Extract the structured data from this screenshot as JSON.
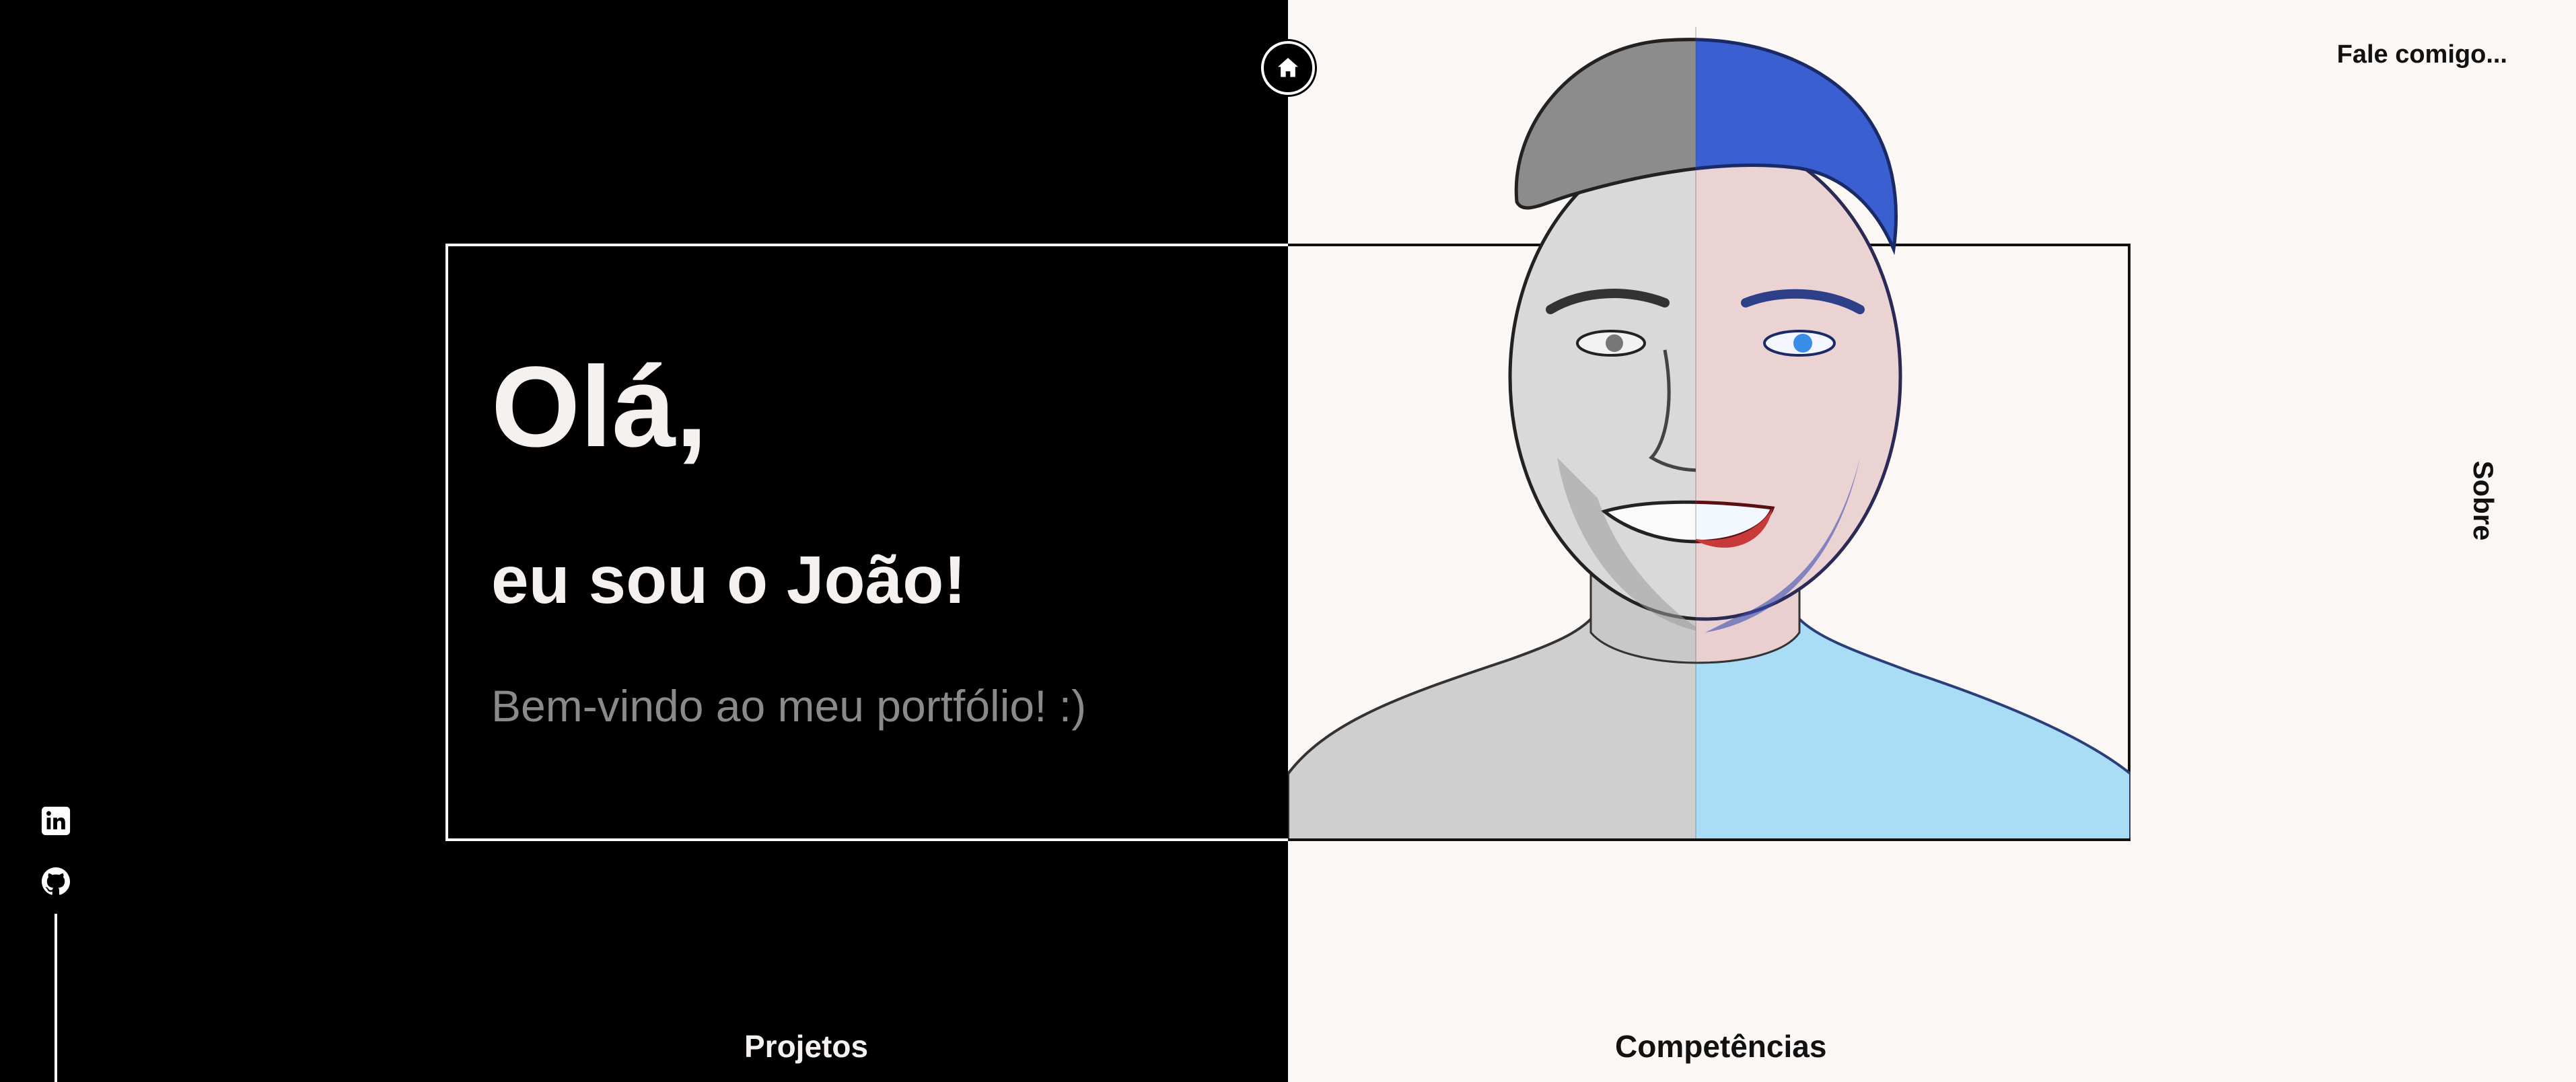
{
  "nav": {
    "contact_label": "Fale comigo...",
    "about_label": "Sobre",
    "projects_label": "Projetos",
    "skills_label": "Competências"
  },
  "hero": {
    "greeting": "Olá,",
    "intro": "eu sou o João!",
    "welcome": "Bem-vindo ao meu portfólio! :)"
  },
  "icons": {
    "home": "home-icon",
    "linkedin": "linkedin-icon",
    "github": "github-icon"
  },
  "colors": {
    "dark_bg": "#000000",
    "light_bg": "#faf7f4",
    "light_text": "#f5f1ee",
    "muted_text": "#8a8a8a",
    "accent_blue": "#3a63d8"
  }
}
